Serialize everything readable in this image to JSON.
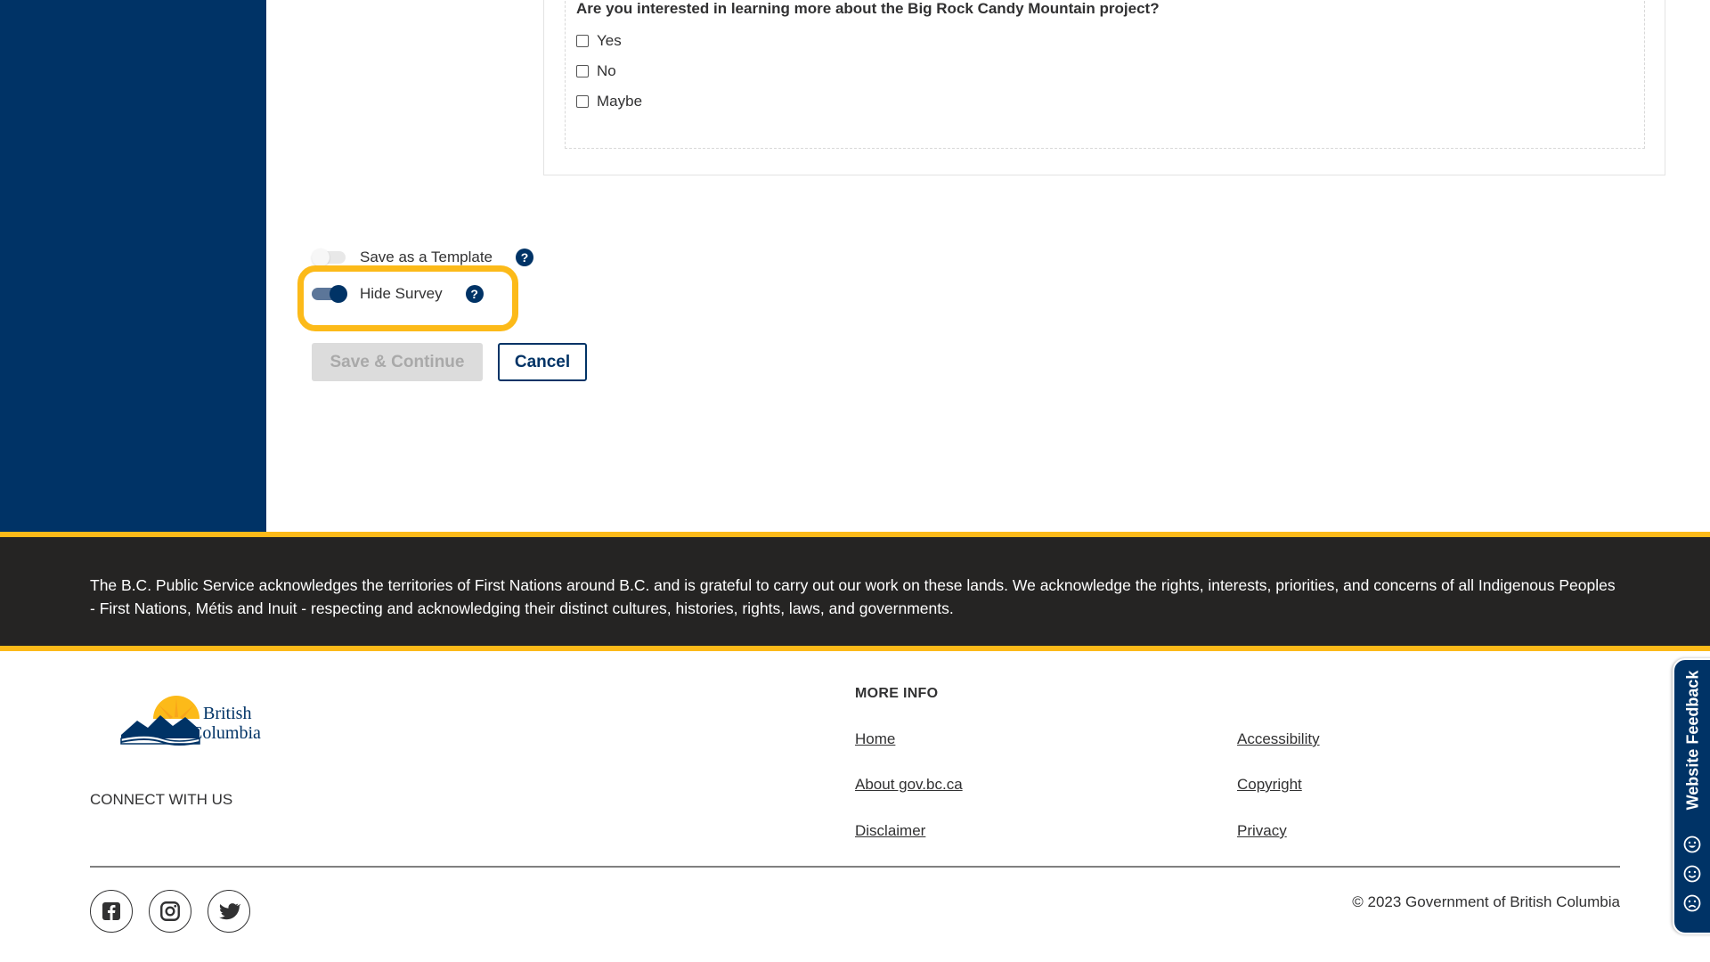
{
  "survey": {
    "question": "Are you interested in learning more about the Big Rock Candy Mountain project?",
    "options": [
      "Yes",
      "No",
      "Maybe"
    ]
  },
  "settings": {
    "save_template_label": "Save as a Template",
    "save_template_on": false,
    "hide_survey_label": "Hide Survey",
    "hide_survey_on": true
  },
  "actions": {
    "save_continue_label": "Save & Continue",
    "cancel_label": "Cancel"
  },
  "acknowledgement": "The B.C. Public Service acknowledges the territories of First Nations around B.C. and is grateful to carry out our work on these lands. We acknowledge the rights, interests, priorities, and concerns of all Indigenous Peoples - First Nations, Métis and Inuit - respecting and acknowledging their distinct cultures, histories, rights, laws, and governments.",
  "footer": {
    "logo_text_line1": "British",
    "logo_text_line2": "Columbia",
    "connect_label": "CONNECT WITH US",
    "more_info_label": "MORE INFO",
    "links": {
      "home": "Home",
      "about": "About gov.bc.ca",
      "disclaimer": "Disclaimer",
      "accessibility": "Accessibility",
      "copyright": "Copyright",
      "privacy": "Privacy"
    },
    "copyright_text": "© 2023 Government of British Columbia",
    "social_icons": [
      "facebook-icon",
      "instagram-icon",
      "twitter-icon"
    ]
  },
  "feedback": {
    "label": "Website Feedback"
  },
  "colors": {
    "primary": "#003366",
    "accent": "#fcba19",
    "dark_band": "#252423"
  }
}
